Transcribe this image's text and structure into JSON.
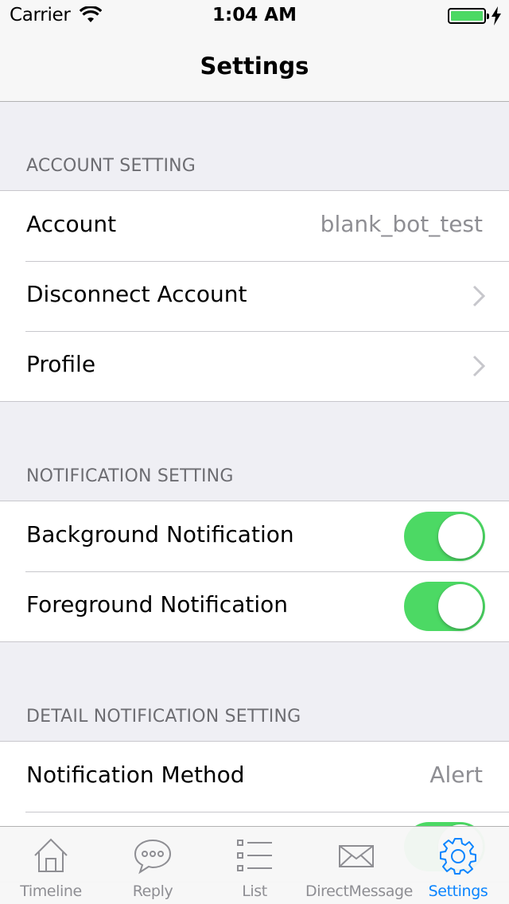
{
  "status_bar": {
    "carrier": "Carrier",
    "time": "1:04 AM",
    "battery_color": "#4cd964"
  },
  "nav": {
    "title": "Settings"
  },
  "sections": {
    "account": {
      "header": "ACCOUNT SETTING",
      "rows": [
        {
          "label": "Account",
          "value": "blank_bot_test"
        },
        {
          "label": "Disconnect Account"
        },
        {
          "label": "Profile"
        }
      ]
    },
    "notification": {
      "header": "NOTIFICATION SETTING",
      "rows": [
        {
          "label": "Background Notification",
          "on": true
        },
        {
          "label": "Foreground Notification",
          "on": true
        }
      ]
    },
    "detail": {
      "header": "DETAIL NOTIFICATION SETTING",
      "rows": [
        {
          "label": "Notification Method",
          "value": "Alert"
        },
        {
          "label": "",
          "on": true
        }
      ]
    }
  },
  "tab_bar": {
    "active_color": "#0a84ff",
    "inactive_color": "#8e8e93",
    "items": [
      {
        "label": "Timeline",
        "icon": "house-icon"
      },
      {
        "label": "Reply",
        "icon": "speech-bubble-icon"
      },
      {
        "label": "List",
        "icon": "list-icon"
      },
      {
        "label": "DirectMessage",
        "icon": "envelope-icon"
      },
      {
        "label": "Settings",
        "icon": "gear-icon",
        "active": true
      }
    ]
  }
}
